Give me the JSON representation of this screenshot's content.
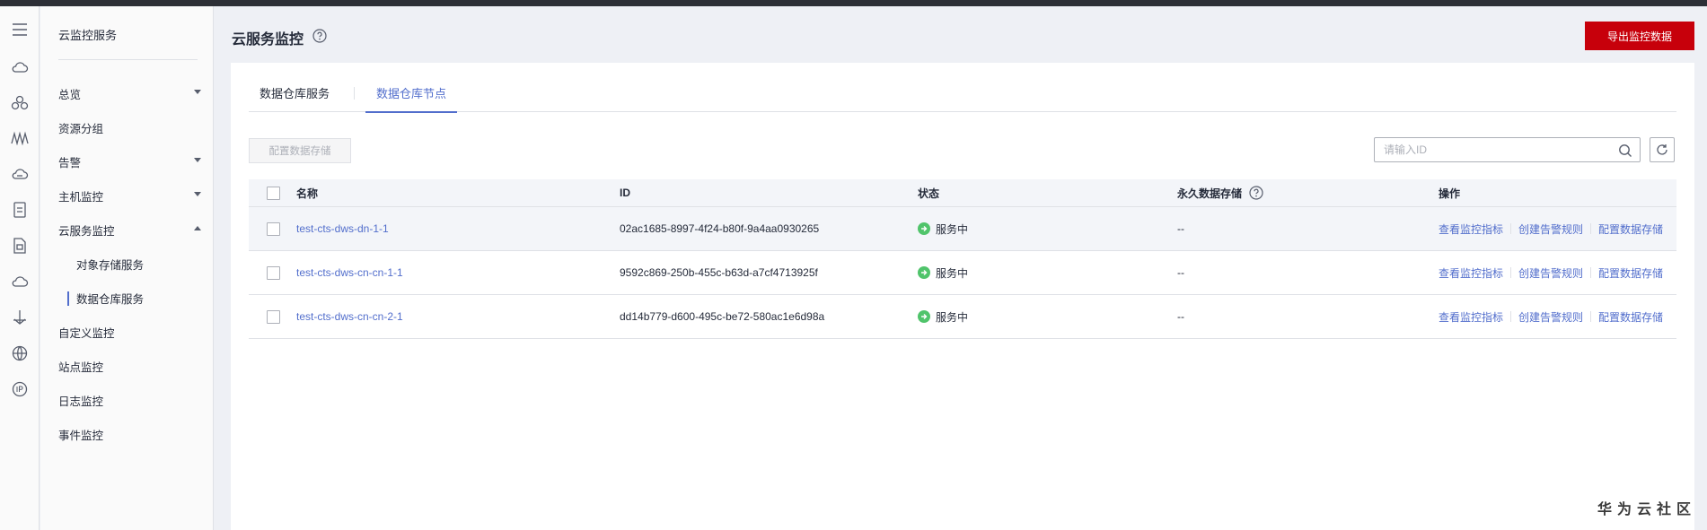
{
  "rail": {
    "icons": [
      "menu-icon",
      "cloud-icon",
      "cluster-icon",
      "waveform-icon",
      "cloud-db-icon",
      "document-icon",
      "file-box-icon",
      "cloud-outline-icon",
      "anchor-icon",
      "globe-icon",
      "ip-icon"
    ]
  },
  "sidebar": {
    "title": "云监控服务",
    "items": [
      {
        "label": "总览",
        "arrow": "down"
      },
      {
        "label": "资源分组",
        "arrow": ""
      },
      {
        "label": "告警",
        "arrow": "down"
      },
      {
        "label": "主机监控",
        "arrow": "down"
      },
      {
        "label": "云服务监控",
        "arrow": "up"
      },
      {
        "label": "对象存储服务",
        "arrow": "",
        "sub": true
      },
      {
        "label": "数据仓库服务",
        "arrow": "",
        "sub": true,
        "active": true
      },
      {
        "label": "自定义监控",
        "arrow": ""
      },
      {
        "label": "站点监控",
        "arrow": ""
      },
      {
        "label": "日志监控",
        "arrow": ""
      },
      {
        "label": "事件监控",
        "arrow": ""
      }
    ]
  },
  "header": {
    "title": "云服务监控",
    "export_label": "导出监控数据"
  },
  "tabs": [
    {
      "label": "数据仓库服务",
      "active": false
    },
    {
      "label": "数据仓库节点",
      "active": true
    }
  ],
  "toolbar": {
    "config_label": "配置数据存储",
    "search_placeholder": "请输入ID"
  },
  "table": {
    "columns": [
      "名称",
      "ID",
      "状态",
      "永久数据存储",
      "操作"
    ],
    "rows": [
      {
        "name": "test-cts-dws-dn-1-1",
        "id": "02ac1685-8997-4f24-b80f-9a4aa0930265",
        "status": "服务中",
        "storage": "--"
      },
      {
        "name": "test-cts-dws-cn-cn-1-1",
        "id": "9592c869-250b-455c-b63d-a7cf4713925f",
        "status": "服务中",
        "storage": "--"
      },
      {
        "name": "test-cts-dws-cn-cn-2-1",
        "id": "dd14b779-d600-495c-be72-580ac1e6d98a",
        "status": "服务中",
        "storage": "--"
      }
    ],
    "actions": [
      "查看监控指标",
      "创建告警规则",
      "配置数据存储"
    ]
  },
  "watermark": "华为云社区",
  "colors": {
    "accent": "#526ecc",
    "brand": "#c7000b",
    "status_ok": "#50c46b"
  }
}
